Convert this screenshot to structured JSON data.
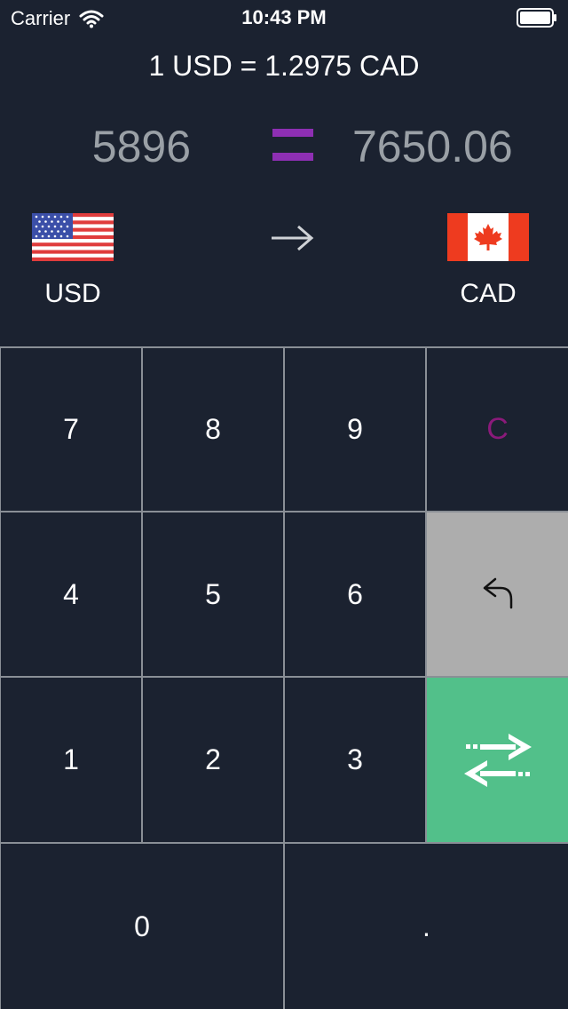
{
  "status_bar": {
    "carrier": "Carrier",
    "time": "10:43 PM"
  },
  "rate_text": "1 USD = 1.2975 CAD",
  "conversion": {
    "from_amount": "5896",
    "to_amount": "7650.06"
  },
  "currencies": {
    "from": {
      "code": "USD",
      "flag": "us-flag-icon"
    },
    "to": {
      "code": "CAD",
      "flag": "canada-flag-icon"
    }
  },
  "keypad": {
    "k7": "7",
    "k8": "8",
    "k9": "9",
    "clear": "C",
    "k4": "4",
    "k5": "5",
    "k6": "6",
    "k1": "1",
    "k2": "2",
    "k3": "3",
    "k0": "0",
    "dot": ".",
    "backspace_icon": "undo-arrow-icon",
    "swap_icon": "swap-arrows-icon"
  },
  "colors": {
    "background": "#1b2230",
    "equals_accent": "#8e2fb3",
    "clear_text": "#8a1a7a",
    "backspace_key": "#adadad",
    "swap_key": "#52c08a"
  }
}
